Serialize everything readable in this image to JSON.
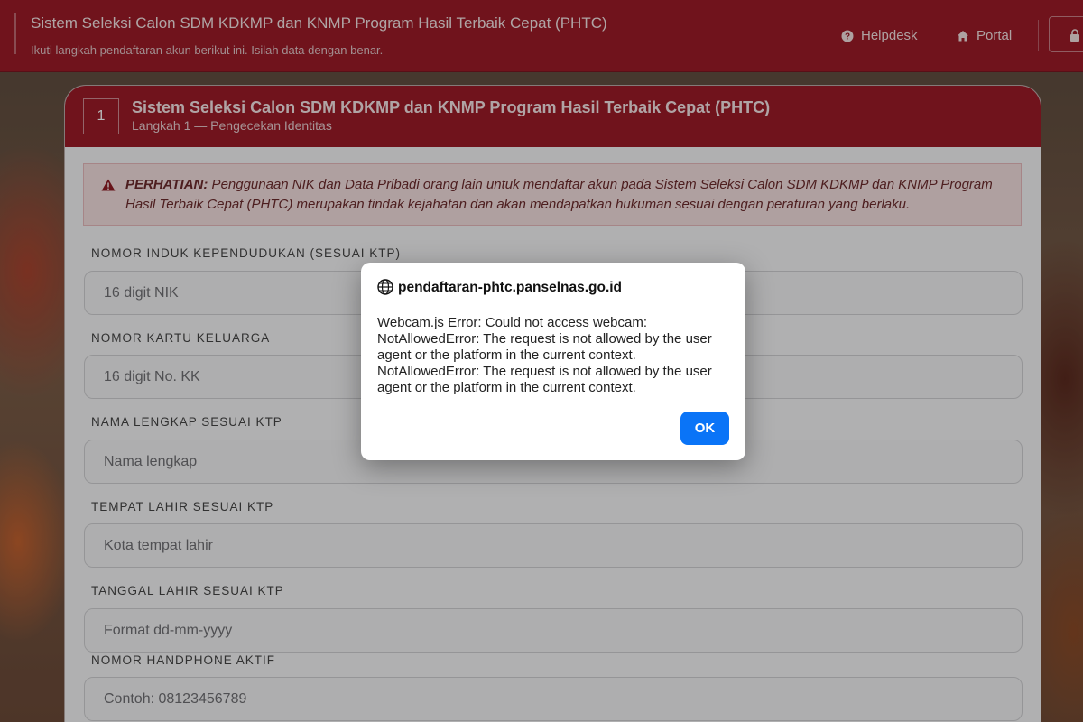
{
  "header": {
    "title": "Sistem Seleksi Calon SDM KDKMP dan KNMP Program Hasil Terbaik Cepat (PHTC)",
    "subtitle": "Ikuti langkah pendaftaran akun berikut ini. Isilah data dengan benar.",
    "nav": [
      {
        "label": "Helpdesk",
        "icon": "question-circle-icon"
      },
      {
        "label": "Portal",
        "icon": "home-icon"
      }
    ],
    "lock_icon": "lock-icon",
    "color": "#9b1b27"
  },
  "card": {
    "step_number": "1",
    "title": "Sistem Seleksi Calon SDM KDKMP dan KNMP Program Hasil Terbaik Cepat (PHTC)",
    "subtitle": "Langkah 1 — Pengecekan Identitas"
  },
  "alert": {
    "icon": "warning-triangle-icon",
    "heading": "PERHATIAN:",
    "text": " Penggunaan NIK dan Data Pribadi orang lain untuk mendaftar akun pada Sistem Seleksi Calon SDM KDKMP dan KNMP Program Hasil Terbaik Cepat (PHTC) merupakan tindak kejahatan dan akan mendapatkan hukuman sesuai dengan peraturan yang berlaku."
  },
  "fields": [
    {
      "label": "NOMOR INDUK KEPENDUDUKAN (SESUAI KTP)",
      "placeholder": "16 digit NIK"
    },
    {
      "label": "NOMOR KARTU KELUARGA",
      "placeholder": "16 digit No. KK"
    },
    {
      "label": "NAMA LENGKAP SESUAI KTP",
      "placeholder": "Nama lengkap"
    },
    {
      "label": "TEMPAT LAHIR SESUAI KTP",
      "placeholder": "Kota tempat lahir"
    },
    {
      "label": "TANGGAL LAHIR SESUAI KTP",
      "placeholder": "Format dd-mm-yyyy"
    },
    {
      "label": "NOMOR HANDPHONE AKTIF",
      "placeholder": "Contoh: 08123456789"
    }
  ],
  "dialog": {
    "host": "pendaftaran-phtc.panselnas.go.id",
    "icon": "globe-icon",
    "message": "Webcam.js Error: Could not access webcam:\nNotAllowedError: The request is not allowed by the user agent or the platform in the current context.\nNotAllowedError: The request is not allowed by the user agent or the platform in the current context.",
    "ok_label": "OK",
    "ok_color": "#0a74f7"
  }
}
